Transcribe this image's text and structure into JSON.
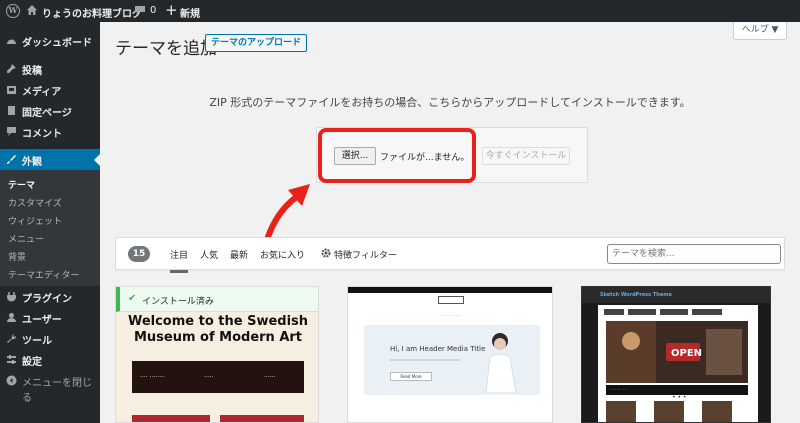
{
  "adminbar": {
    "site_name": "りょうのお料理ブログ",
    "comment_count": "0",
    "new_label": "新規"
  },
  "sidebar": {
    "items": [
      {
        "label": "ダッシュボード",
        "icon": "dashboard-icon"
      },
      {
        "label": "投稿",
        "icon": "pin-icon"
      },
      {
        "label": "メディア",
        "icon": "media-icon"
      },
      {
        "label": "固定ページ",
        "icon": "page-icon"
      },
      {
        "label": "コメント",
        "icon": "comment-icon"
      },
      {
        "label": "外観",
        "icon": "brush-icon"
      },
      {
        "label": "プラグイン",
        "icon": "plugin-icon"
      },
      {
        "label": "ユーザー",
        "icon": "user-icon"
      },
      {
        "label": "ツール",
        "icon": "wrench-icon"
      },
      {
        "label": "設定",
        "icon": "settings-icon"
      },
      {
        "label": "メニューを閉じる",
        "icon": "collapse-icon"
      }
    ],
    "submenu": [
      "テーマ",
      "カスタマイズ",
      "ウィジェット",
      "メニュー",
      "背景",
      "テーマエディター"
    ]
  },
  "header": {
    "title": "テーマを追加",
    "upload_button": "テーマのアップロード",
    "help": "ヘルプ ▼"
  },
  "upload": {
    "description": "ZIP 形式のテーマファイルをお持ちの場合、こちらからアップロードしてインストールできます。",
    "choose_file": "選択...",
    "file_status": "ファイルが...ません。",
    "install_now": "今すぐインストール"
  },
  "filter": {
    "count": "15",
    "tabs": [
      "注目",
      "人気",
      "最新",
      "お気に入り"
    ],
    "feature_filter": "特徴フィルター",
    "search_placeholder": "テーマを検索..."
  },
  "themes": {
    "installed_label": "インストール済み",
    "card1": {
      "title_line1": "Welcome to the Swedish",
      "title_line2": "Museum of Modern Art"
    },
    "card2": {
      "hero_title": "Hi, I am Header Media Title",
      "hero_button": "Read More"
    },
    "card3": {
      "site_title": "Sketch WordPress Theme"
    }
  },
  "colors": {
    "admin_dark": "#23282d",
    "admin_blue": "#0073aa",
    "highlight_red": "#e8211a",
    "installed_green": "#46b450"
  }
}
